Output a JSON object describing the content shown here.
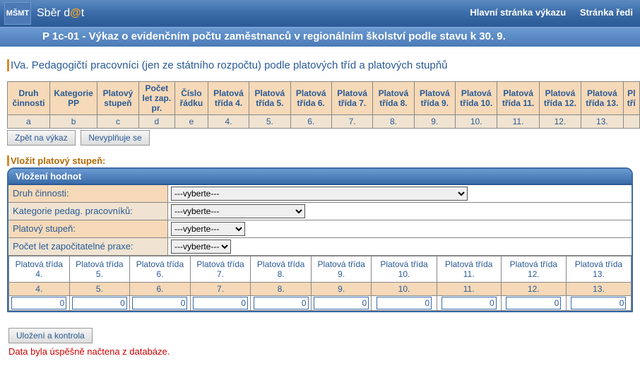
{
  "header": {
    "brand_prefix": "Sběr d",
    "brand_at": "@",
    "brand_suffix": "t",
    "logo_text": "MŠMT",
    "link1": "Hlavní stránka výkazu",
    "link2": "Stránka ředi"
  },
  "subtitle": "P 1c-01 - Výkaz o evidenčním počtu zaměstnanců v regionálním školství podle stavu k 30. 9.",
  "section_title": "IVa. Pedagogičtí pracovníci (jen ze státního rozpočtu) podle platových tříd a platových stupňů",
  "maincols": {
    "h": [
      "Druh činnosti",
      "Kategorie PP",
      "Platový stupeň",
      "Počet let zap. pr.",
      "Číslo řádku",
      "Platová třída 4.",
      "Platová třída 5.",
      "Platová třída 6.",
      "Platová třída 7.",
      "Platová třída 8.",
      "Platová třída 9.",
      "Platová třída 10.",
      "Platová třída 11.",
      "Platová třída 12.",
      "Platová třída 13.",
      "Pl tří"
    ],
    "r2": [
      "a",
      "b",
      "c",
      "d",
      "e",
      "4.",
      "5.",
      "6.",
      "7.",
      "8.",
      "9.",
      "10.",
      "11.",
      "12.",
      "13."
    ]
  },
  "buttons": {
    "back": "Zpět na výkaz",
    "nofill": "Nevyplňuje se",
    "save": "Uložení a kontrola"
  },
  "insert_title": "Vložit platový stupeň:",
  "panel_title": "Vložení hodnot",
  "form": {
    "lab_druh": "Druh činnosti:",
    "lab_kat": "Kategorie pedag. pracovníků:",
    "lab_stup": "Platový stupeň:",
    "lab_praxe": "Počet let započitatelné praxe:",
    "opt_vyberte": "---vyberte---",
    "opt_vyberte_short": "---vyberte---"
  },
  "classcols": {
    "top": [
      "Platová třída 4.",
      "Platová třída 5.",
      "Platová třída 6.",
      "Platová třída 7.",
      "Platová třída 8.",
      "Platová třída 9.",
      "Platová třída 10.",
      "Platová třída 11.",
      "Platová třída 12.",
      "Platová třída 13."
    ],
    "nums": [
      "4.",
      "5.",
      "6.",
      "7.",
      "8.",
      "9.",
      "10.",
      "11.",
      "12.",
      "13."
    ],
    "vals": [
      "0",
      "0",
      "0",
      "0",
      "0",
      "0",
      "0",
      "0",
      "0",
      "0"
    ]
  },
  "message": "Data byla úspěšně načtena z databáze."
}
